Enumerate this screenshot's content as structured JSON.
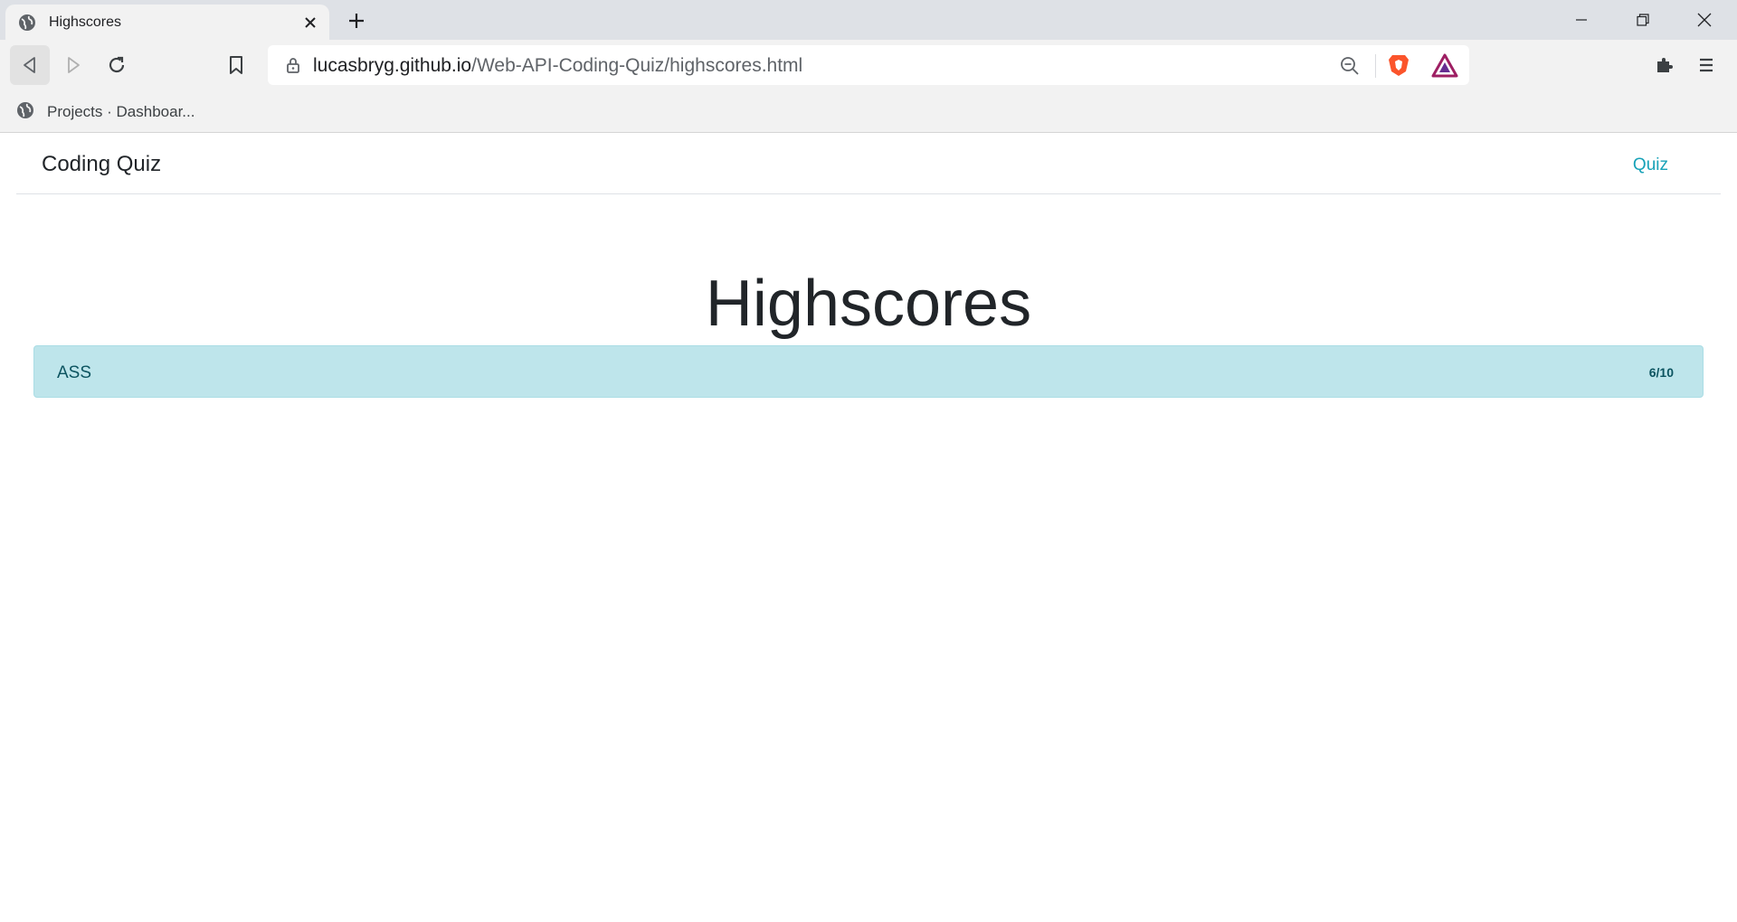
{
  "browser": {
    "tab_title": "Highscores",
    "url_host": "lucasbryg.github.io",
    "url_path": "/Web-API-Coding-Quiz/highscores.html",
    "bookmark_label": "Projects · Dashboar..."
  },
  "navbar": {
    "brand": "Coding Quiz",
    "link": "Quiz"
  },
  "main": {
    "title": "Highscores",
    "scores": [
      {
        "name": "ASS",
        "score": "6/10"
      }
    ]
  },
  "colors": {
    "accent_link": "#17a2b8",
    "list_item_bg": "#bee5eb",
    "list_item_text": "#0c5460"
  }
}
